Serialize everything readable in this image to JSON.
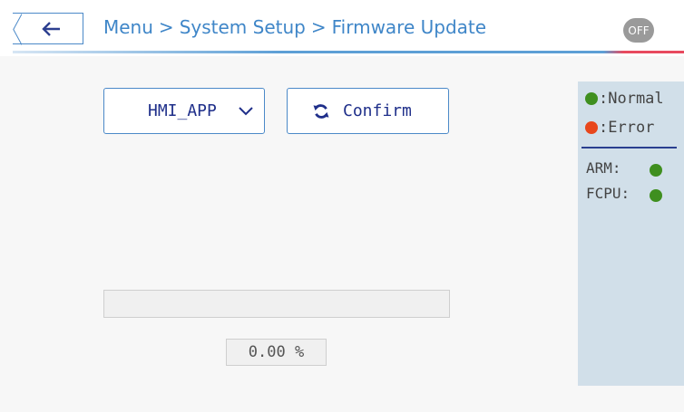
{
  "header": {
    "breadcrumb": [
      "Menu",
      "System Setup",
      "Firmware Update"
    ],
    "separator": ">",
    "power_toggle_label": "OFF"
  },
  "controls": {
    "firmware_select_value": "HMI_APP",
    "confirm_label": "Confirm"
  },
  "progress": {
    "value": 0.0,
    "text": "0.00 %"
  },
  "status_panel": {
    "legend": [
      {
        "label": ":Normal",
        "color": "#3f8f1f"
      },
      {
        "label": ":Error",
        "color": "#e8471c"
      }
    ],
    "items": [
      {
        "label": "ARM:",
        "color": "#3f8f1f"
      },
      {
        "label": "FCPU:",
        "color": "#3f8f1f"
      }
    ]
  },
  "colors": {
    "accent": "#4b89c8",
    "text_dark_blue": "#1f2f8a",
    "panel_bg": "#d1dfe9"
  },
  "icons": {
    "back": "left-arrow-icon",
    "dropdown": "chevron-down-icon",
    "confirm": "refresh-icon"
  }
}
